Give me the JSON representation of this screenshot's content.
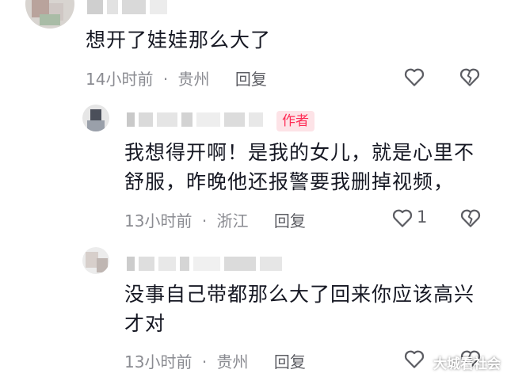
{
  "comments": [
    {
      "text": "想开了娃娃那么大了",
      "time": "14小时前",
      "separator": "·",
      "location": "贵州",
      "reply_label": "回复",
      "like_count": ""
    },
    {
      "author_badge": "作者",
      "text": "我想得开啊！是我的女儿，就是心里不舒服，昨晚他还报警要我删掉视频，",
      "time": "13小时前",
      "separator": "·",
      "location": "浙江",
      "reply_label": "回复",
      "like_count": "1"
    },
    {
      "text": "没事自己带都那么大了回来你应该高兴才对",
      "time": "13小时前",
      "separator": "·",
      "location": "贵州",
      "reply_label": "回复",
      "like_count": ""
    }
  ],
  "watermark": "大城看社会",
  "icons": {
    "like": "heart-outline-icon",
    "dislike": "broken-heart-icon"
  },
  "colors": {
    "text": "#161823",
    "meta": "#8a8b91",
    "author_badge_bg": "#fde3e7",
    "author_badge_fg": "#fe2c55"
  }
}
